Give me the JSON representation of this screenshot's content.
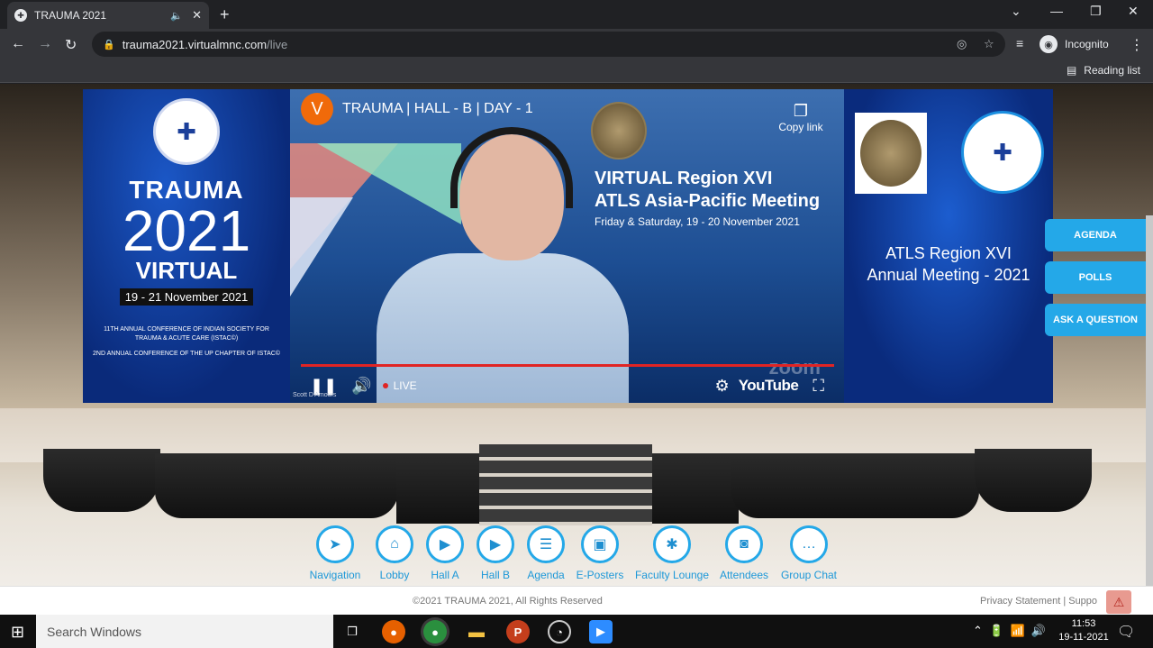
{
  "browser": {
    "tab_title": "TRAUMA 2021",
    "url_host": "trauma2021.virtualmnc.com",
    "url_path": "/live",
    "profile_label": "Incognito",
    "reading_list": "Reading list"
  },
  "left_panel": {
    "title1": "TRAUMA",
    "title2": "2021",
    "title3": "VIRTUAL",
    "date": "19 - 21 November 2021",
    "conf1": "11TH ANNUAL CONFERENCE OF INDIAN SOCIETY FOR TRAUMA & ACUTE CARE (ISTAC©)",
    "conf2": "2ND ANNUAL CONFERENCE OF THE UP CHAPTER OF ISTAC©"
  },
  "video": {
    "channel_initial": "V",
    "title": "TRAUMA | HALL - B | DAY - 1",
    "copy_link": "Copy link",
    "slide_line1": "VIRTUAL  Region XVI",
    "slide_line2": "ATLS Asia-Pacific Meeting",
    "slide_line3": "Friday & Saturday, 19 - 20 November 2021",
    "live_label": "LIVE",
    "youtube_label": "YouTube",
    "zoom_watermark": "zoom",
    "speaker_name": "Scott D'Amours"
  },
  "right_panel": {
    "meeting_line1": "ATLS Region XVI",
    "meeting_line2": "Annual Meeting - 2021"
  },
  "side_buttons": [
    "AGENDA",
    "POLLS",
    "ASK A QUESTION"
  ],
  "nav_items": [
    {
      "label": "Navigation",
      "icon": "➤"
    },
    {
      "label": "Lobby",
      "icon": "⌂"
    },
    {
      "label": "Hall A",
      "icon": "▶"
    },
    {
      "label": "Hall B",
      "icon": "▶"
    },
    {
      "label": "Agenda",
      "icon": "☰"
    },
    {
      "label": "E-Posters",
      "icon": "▣"
    },
    {
      "label": "Faculty Lounge",
      "icon": "✱"
    },
    {
      "label": "Attendees",
      "icon": "◙"
    },
    {
      "label": "Group Chat",
      "icon": "…"
    }
  ],
  "footer": {
    "copyright": "©2021 TRAUMA 2021, All Rights Reserved",
    "links": "Privacy Statement | Suppo"
  },
  "taskbar": {
    "search_placeholder": "Search Windows",
    "time": "11:53",
    "date": "19-11-2021"
  }
}
